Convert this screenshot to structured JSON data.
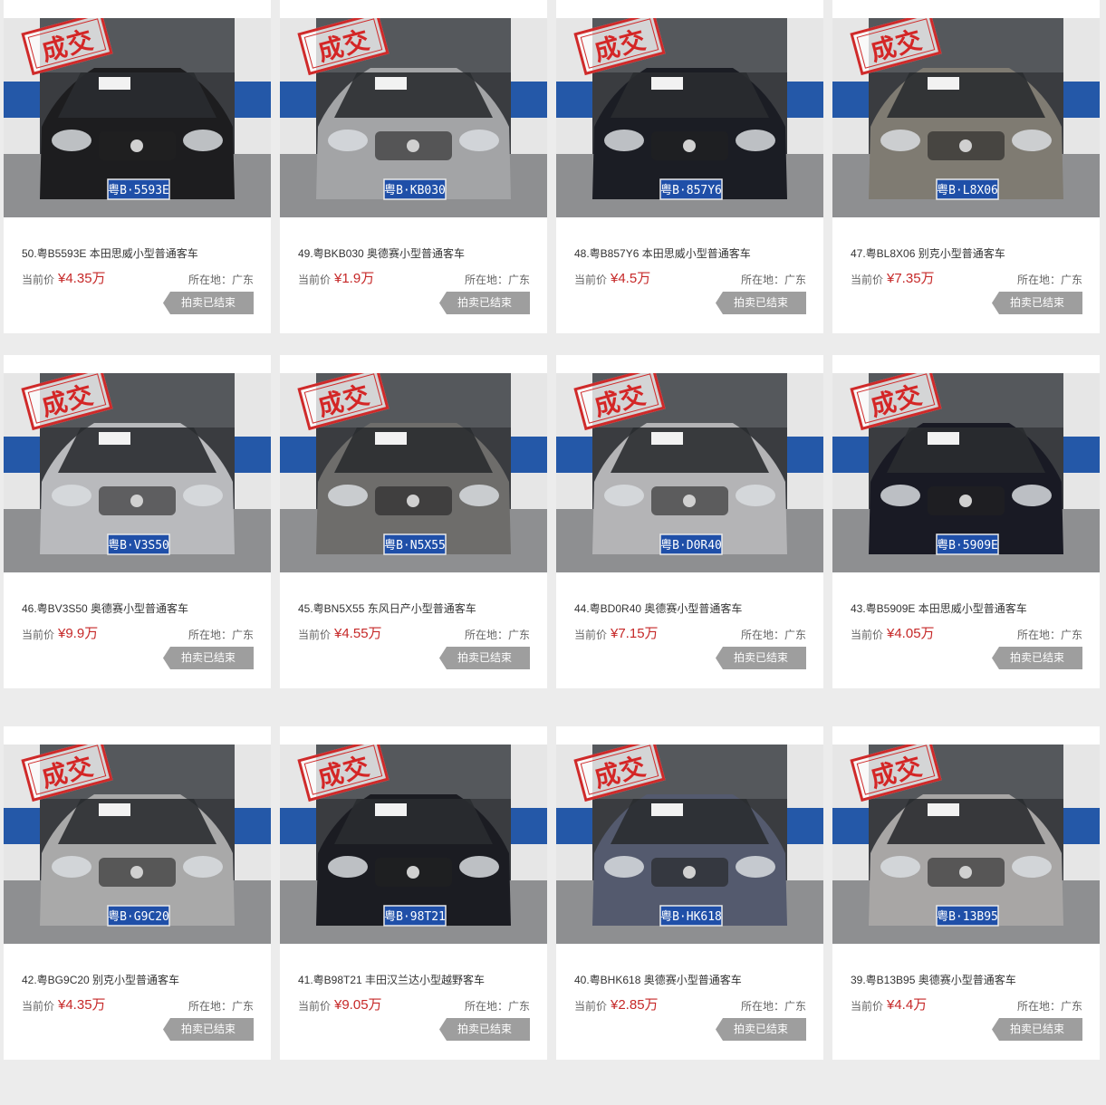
{
  "listing": {
    "stamp_text": "成交",
    "price_label": "当前价",
    "status_label": "拍卖已结束",
    "cards": [
      {
        "title": "50.粤B5593E 本田思威小型普通客车",
        "price": "¥4.35万",
        "location": "所在地：广东",
        "plate": "粤B·5593E",
        "car_color": "#1d1d1f",
        "plate_color": "#1f4fa8"
      },
      {
        "title": "49.粤BKB030 奥德赛小型普通客车",
        "price": "¥1.9万",
        "location": "所在地：广东",
        "plate": "粤B·KB030",
        "car_color": "#a3a4a6",
        "plate_color": "#1f4fa8"
      },
      {
        "title": "48.粤B857Y6 本田思威小型普通客车",
        "price": "¥4.5万",
        "location": "所在地：广东",
        "plate": "粤B·857Y6",
        "car_color": "#1b1d24",
        "plate_color": "#1f4fa8"
      },
      {
        "title": "47.粤BL8X06 别克小型普通客车",
        "price": "¥7.35万",
        "location": "所在地：广东",
        "plate": "粤B·L8X06",
        "car_color": "#7f7b72",
        "plate_color": "#1f4fa8"
      },
      {
        "title": "46.粤BV3S50 奥德赛小型普通客车",
        "price": "¥9.9万",
        "location": "所在地：广东",
        "plate": "粤B·V3S50",
        "car_color": "#b9babd",
        "plate_color": "#1f4fa8"
      },
      {
        "title": "45.粤BN5X55 东风日产小型普通客车",
        "price": "¥4.55万",
        "location": "所在地：广东",
        "plate": "粤B·N5X55",
        "car_color": "#6e6d6b",
        "plate_color": "#1f4fa8"
      },
      {
        "title": "44.粤BD0R40 奥德赛小型普通客车",
        "price": "¥7.15万",
        "location": "所在地：广东",
        "plate": "粤B·D0R40",
        "car_color": "#b4b4b6",
        "plate_color": "#1f4fa8"
      },
      {
        "title": "43.粤B5909E 本田思威小型普通客车",
        "price": "¥4.05万",
        "location": "所在地：广东",
        "plate": "粤B·5909E",
        "car_color": "#191a24",
        "plate_color": "#1f4fa8"
      },
      {
        "title": "42.粤BG9C20 别克小型普通客车",
        "price": "¥4.35万",
        "location": "所在地：广东",
        "plate": "粤B·G9C20",
        "car_color": "#a9a9a9",
        "plate_color": "#1f4fa8"
      },
      {
        "title": "41.粤B98T21 丰田汉兰达小型越野客车",
        "price": "¥9.05万",
        "location": "所在地：广东",
        "plate": "粤B·98T21",
        "car_color": "#1b1c22",
        "plate_color": "#1f4fa8"
      },
      {
        "title": "40.粤BHK618 奥德赛小型普通客车",
        "price": "¥2.85万",
        "location": "所在地：广东",
        "plate": "粤B·HK618",
        "car_color": "#545a6e",
        "plate_color": "#1f4fa8"
      },
      {
        "title": "39.粤B13B95 奥德赛小型普通客车",
        "price": "¥4.4万",
        "location": "所在地：广东",
        "plate": "粤B·13B95",
        "car_color": "#a8a6a5",
        "plate_color": "#1f4fa8"
      }
    ]
  }
}
